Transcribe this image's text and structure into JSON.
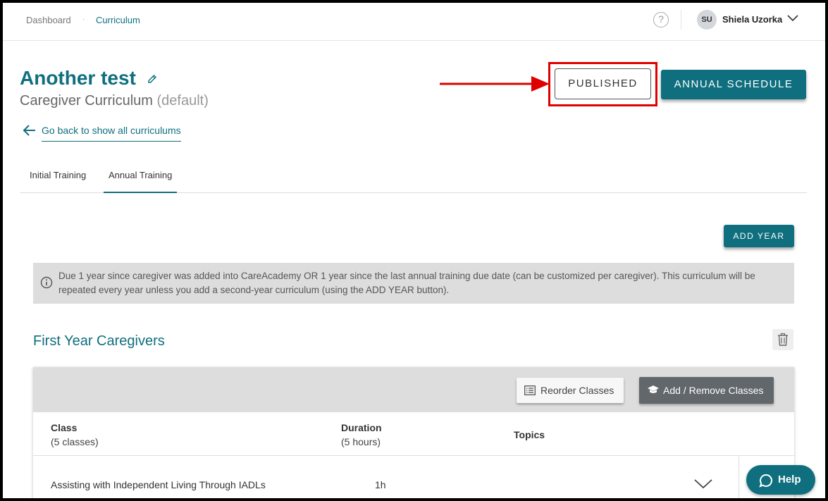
{
  "breadcrumb": {
    "items": [
      "Dashboard",
      "Curriculum"
    ],
    "separator": "·"
  },
  "header": {
    "help_glyph": "?",
    "user": {
      "initials": "SU",
      "name": "Shiela Uzorka"
    }
  },
  "curriculum": {
    "title": "Another test",
    "subtitle": "Caregiver Curriculum",
    "subtitle_suffix": "(default)",
    "back_link": "Go back to show all curriculums"
  },
  "actions": {
    "published_label": "PUBLISHED",
    "annual_schedule_label": "ANNUAL SCHEDULE"
  },
  "tabs": [
    {
      "label": "Initial Training",
      "active": false
    },
    {
      "label": "Annual Training",
      "active": true
    }
  ],
  "add_year_label": "ADD YEAR",
  "info_text": "Due 1 year since caregiver was added into CareAcademy OR 1 year since the last annual training due date (can be customized per caregiver). This curriculum will be repeated every year unless you add a second-year curriculum (using the ADD YEAR button).",
  "year_section": {
    "title": "First Year Caregivers",
    "reorder_label": "Reorder Classes",
    "add_remove_label": "Add / Remove Classes",
    "columns": {
      "class": "Class",
      "class_sub": "(5 classes)",
      "duration": "Duration",
      "duration_sub": "(5 hours)",
      "topics": "Topics"
    },
    "rows": [
      {
        "class": "Assisting with Independent Living Through IADLs",
        "duration": "1h"
      }
    ]
  },
  "help_button": "Help",
  "colors": {
    "accent": "#0f6f7e",
    "annotation_red": "#e00000",
    "panel_gray": "#dddddd",
    "button_dark": "#62676c"
  },
  "icons": [
    "help-circle-icon",
    "chevron-down-icon",
    "pencil-icon",
    "arrow-left-icon",
    "info-icon",
    "trash-icon",
    "list-icon",
    "graduation-cap-icon",
    "chat-bubble-icon"
  ]
}
